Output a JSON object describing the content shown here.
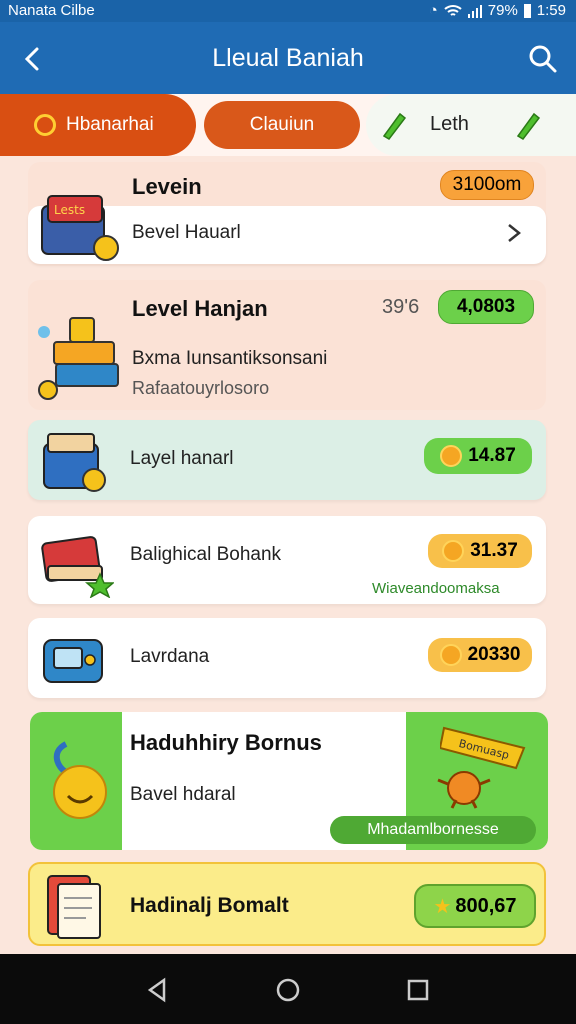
{
  "status_bar": {
    "carrier": "Nanata  Cilbe",
    "battery": "79%",
    "time": "1:59"
  },
  "app_bar": {
    "title": "Lleual Baniah"
  },
  "tabs": [
    {
      "label": "Hbanarhai"
    },
    {
      "label": "Clauiun"
    },
    {
      "label": "Leth"
    }
  ],
  "cards": [
    {
      "title": "Levein",
      "sub": "Bevel Hauarl",
      "badge": "3100om",
      "icon_label": "Lests"
    },
    {
      "title": "Level Hanjan",
      "percent": "39'6",
      "badge": "4,0803",
      "line1": "Bxma Iunsantiksonsani",
      "line2": "Rafaatouyrlosoro"
    },
    {
      "label": "Layel hanarl",
      "badge": "14.87"
    },
    {
      "label": "Balighical Bohank",
      "badge": "31.37",
      "note": "Wiaveandoomaksa"
    },
    {
      "label": "Lavrdana",
      "badge": "20330"
    },
    {
      "title": "Haduhhiry Bornus",
      "sub": "Bavel hdaral",
      "banner_text": "Bomuasp",
      "badge": "Mhadamlbornesse"
    },
    {
      "title": "Hadinalj Bomalt",
      "badge": "800,67"
    }
  ],
  "colors": {
    "appbar": "#1f6bb4",
    "tab_active": "#d94f12",
    "gold": "#f5a623",
    "green": "#6cd04a"
  }
}
